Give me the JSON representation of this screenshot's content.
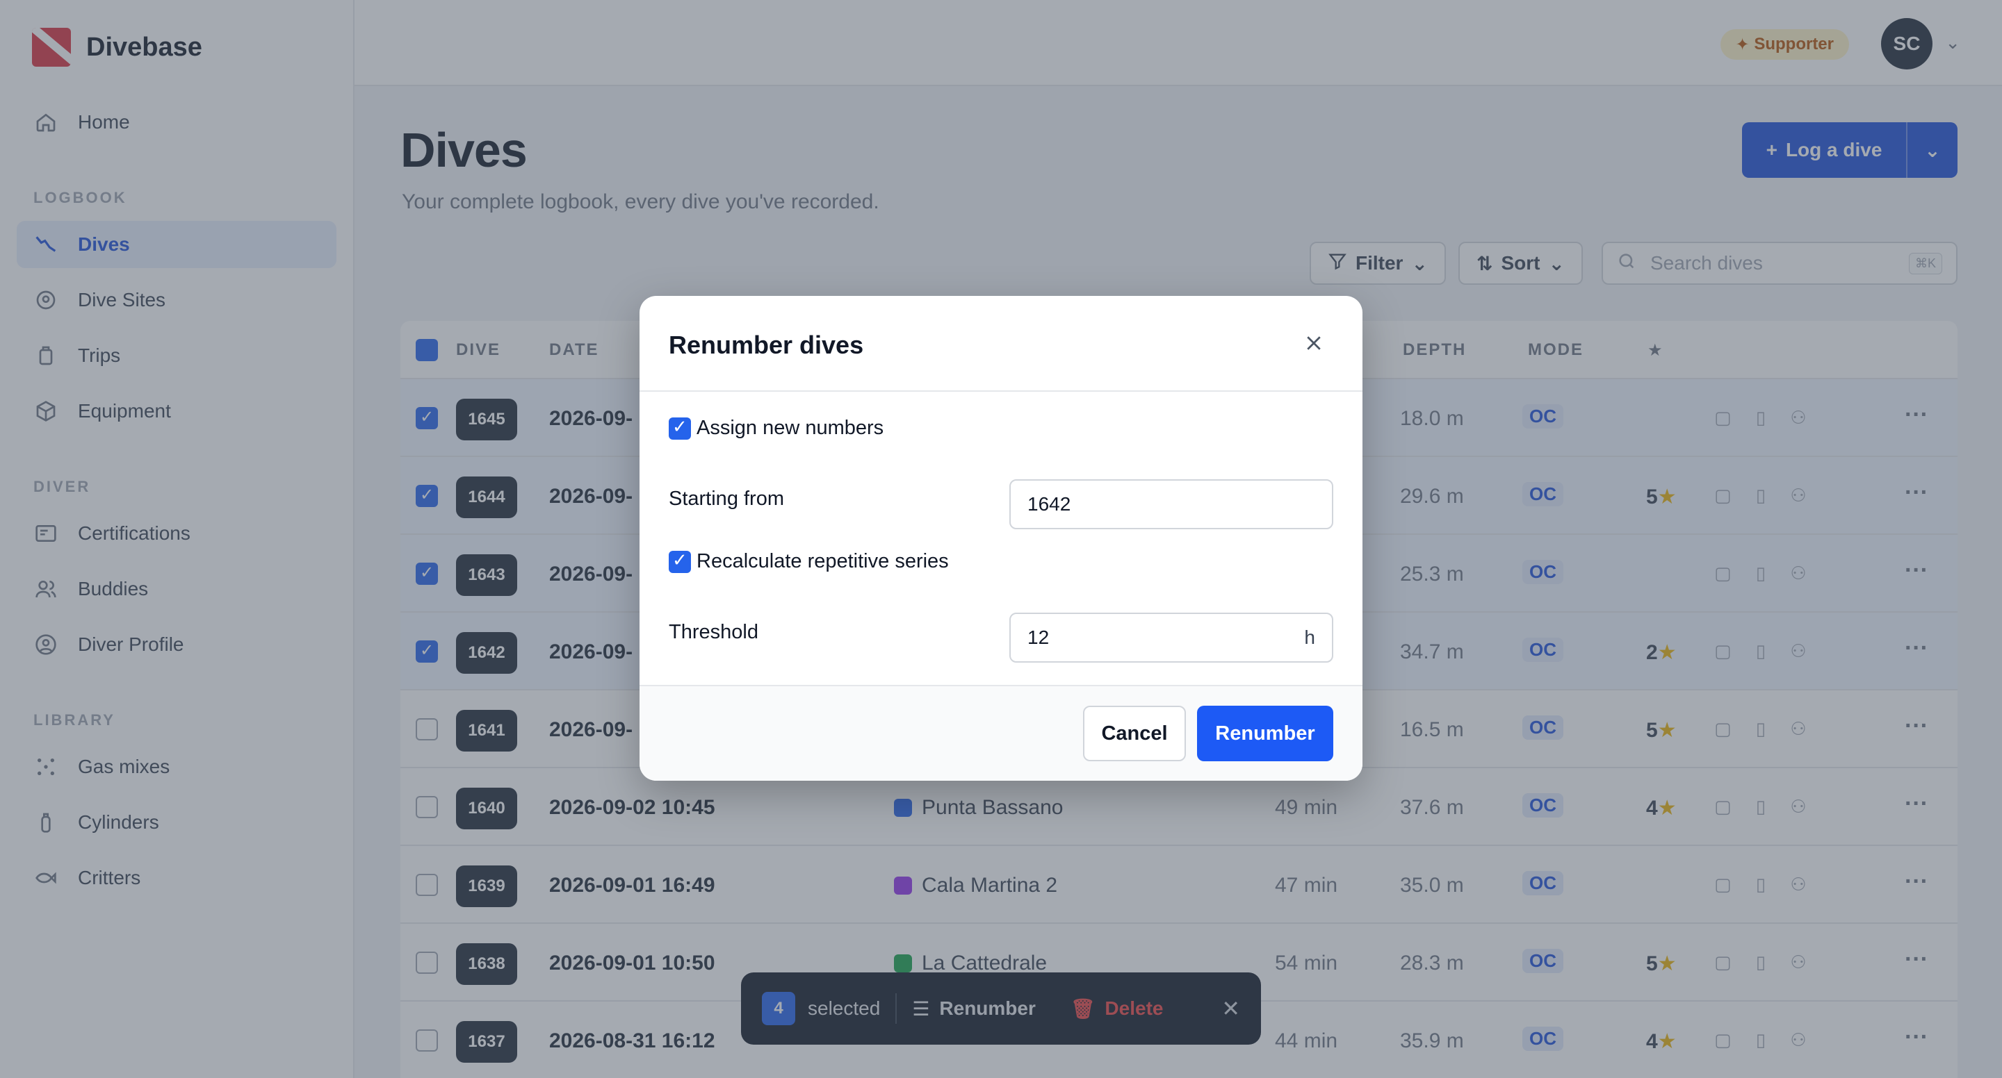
{
  "app": {
    "name": "Divebase"
  },
  "sidebar": {
    "items": [
      {
        "label": "Home",
        "icon": "home-icon"
      },
      {
        "section": "LOGBOOK"
      },
      {
        "label": "Dives",
        "icon": "dive-profile-icon",
        "active": true
      },
      {
        "label": "Dive Sites",
        "icon": "map-pin-icon"
      },
      {
        "label": "Trips",
        "icon": "luggage-icon"
      },
      {
        "label": "Equipment",
        "icon": "box-icon"
      },
      {
        "section": "DIVER"
      },
      {
        "label": "Certifications",
        "icon": "id-card-icon"
      },
      {
        "label": "Buddies",
        "icon": "users-icon"
      },
      {
        "label": "Diver Profile",
        "icon": "user-circle-icon"
      },
      {
        "section": "LIBRARY"
      },
      {
        "label": "Gas mixes",
        "icon": "molecule-icon"
      },
      {
        "label": "Cylinders",
        "icon": "cylinder-icon"
      },
      {
        "label": "Critters",
        "icon": "fish-icon"
      }
    ],
    "sections": {
      "logbook": "LOGBOOK",
      "diver": "DIVER",
      "library": "LIBRARY"
    },
    "labels": {
      "home": "Home",
      "dives": "Dives",
      "dive_sites": "Dive Sites",
      "trips": "Trips",
      "equipment": "Equipment",
      "certifications": "Certifications",
      "buddies": "Buddies",
      "diver_profile": "Diver Profile",
      "gas_mixes": "Gas mixes",
      "cylinders": "Cylinders",
      "critters": "Critters"
    }
  },
  "topbar": {
    "supporter": "Supporter",
    "avatar_initials": "SC"
  },
  "page": {
    "title": "Dives",
    "subtitle": "Your complete logbook, every dive you've recorded.",
    "log_button": "Log a dive",
    "filter_label": "Filter",
    "sort_label": "Sort",
    "search_placeholder": "Search dives",
    "search_shortcut": "⌘K"
  },
  "table": {
    "headers": {
      "dive": "DIVE",
      "date": "DATE",
      "depth": "DEPTH",
      "mode": "MODE",
      "rating": "★"
    },
    "rows": [
      {
        "num": "1645",
        "date": "2026-09-",
        "site": "",
        "duration": "",
        "depth": "18.0 m",
        "mode": "OC",
        "rating": "",
        "selected": true
      },
      {
        "num": "1644",
        "date": "2026-09-",
        "site": "",
        "duration": "",
        "depth": "29.6 m",
        "mode": "OC",
        "rating": "5",
        "selected": true
      },
      {
        "num": "1643",
        "date": "2026-09-",
        "site": "",
        "duration": "",
        "depth": "25.3 m",
        "mode": "OC",
        "rating": "",
        "selected": true
      },
      {
        "num": "1642",
        "date": "2026-09-",
        "site": "",
        "duration": "",
        "depth": "34.7 m",
        "mode": "OC",
        "rating": "2",
        "selected": true
      },
      {
        "num": "1641",
        "date": "2026-09-",
        "site": "",
        "duration": "",
        "depth": "16.5 m",
        "mode": "OC",
        "rating": "5",
        "selected": false
      },
      {
        "num": "1640",
        "date": "2026-09-02 10:45",
        "site": "Punta Bassano",
        "duration": "49 min",
        "depth": "37.6 m",
        "mode": "OC",
        "rating": "4",
        "selected": false
      },
      {
        "num": "1639",
        "date": "2026-09-01 16:49",
        "site": "Cala Martina 2",
        "duration": "47 min",
        "depth": "35.0 m",
        "mode": "OC",
        "rating": "",
        "selected": false
      },
      {
        "num": "1638",
        "date": "2026-09-01 10:50",
        "site": "La Cattedrale",
        "duration": "54 min",
        "depth": "28.3 m",
        "mode": "OC",
        "rating": "5",
        "selected": false
      },
      {
        "num": "1637",
        "date": "2026-08-31 16:12",
        "site": "",
        "duration": "44 min",
        "depth": "35.9 m",
        "mode": "OC",
        "rating": "4",
        "selected": false
      }
    ]
  },
  "bulkbar": {
    "count": "4",
    "selected_label": "selected",
    "renumber_label": "Renumber",
    "delete_label": "Delete"
  },
  "dialog": {
    "title": "Renumber dives",
    "assign_label": "Assign new numbers",
    "assign_checked": true,
    "starting_label": "Starting from",
    "starting_value": "1642",
    "recalc_label": "Recalculate repetitive series",
    "recalc_checked": true,
    "threshold_label": "Threshold",
    "threshold_value": "12",
    "threshold_unit": "h",
    "cancel_label": "Cancel",
    "submit_label": "Renumber"
  },
  "colors": {
    "accent": "#1d5af5",
    "brand": "#d9303e",
    "star": "#eab308",
    "danger": "#ef4444"
  }
}
